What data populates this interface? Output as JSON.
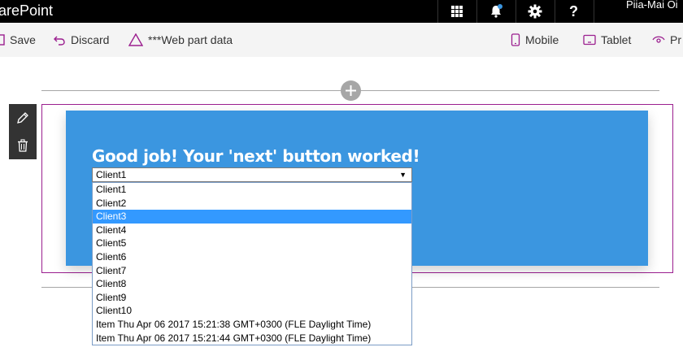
{
  "suite": {
    "title": "arePoint",
    "user": "Piia-Mai Oi"
  },
  "commands": {
    "save": "Save",
    "discard": "Discard",
    "webpart_data": "***Web part data",
    "mobile": "Mobile",
    "tablet": "Tablet",
    "preview": "Pr"
  },
  "webpart": {
    "title": "Good job! Your 'next' button worked!",
    "selected_value": "Client1",
    "background_color": "#3b96e0",
    "options": [
      "Client1",
      "Client2",
      "Client3",
      "Client4",
      "Client5",
      "Client6",
      "Client7",
      "Client8",
      "Client9",
      "Client10",
      "Item Thu Apr 06 2017 15:21:38 GMT+0300 (FLE Daylight Time)",
      "Item Thu Apr 06 2017 15:21:44 GMT+0300 (FLE Daylight Time)"
    ],
    "highlighted_option": "Client3"
  },
  "colors": {
    "accent": "#9b1f8f",
    "highlight": "#3399ff"
  }
}
